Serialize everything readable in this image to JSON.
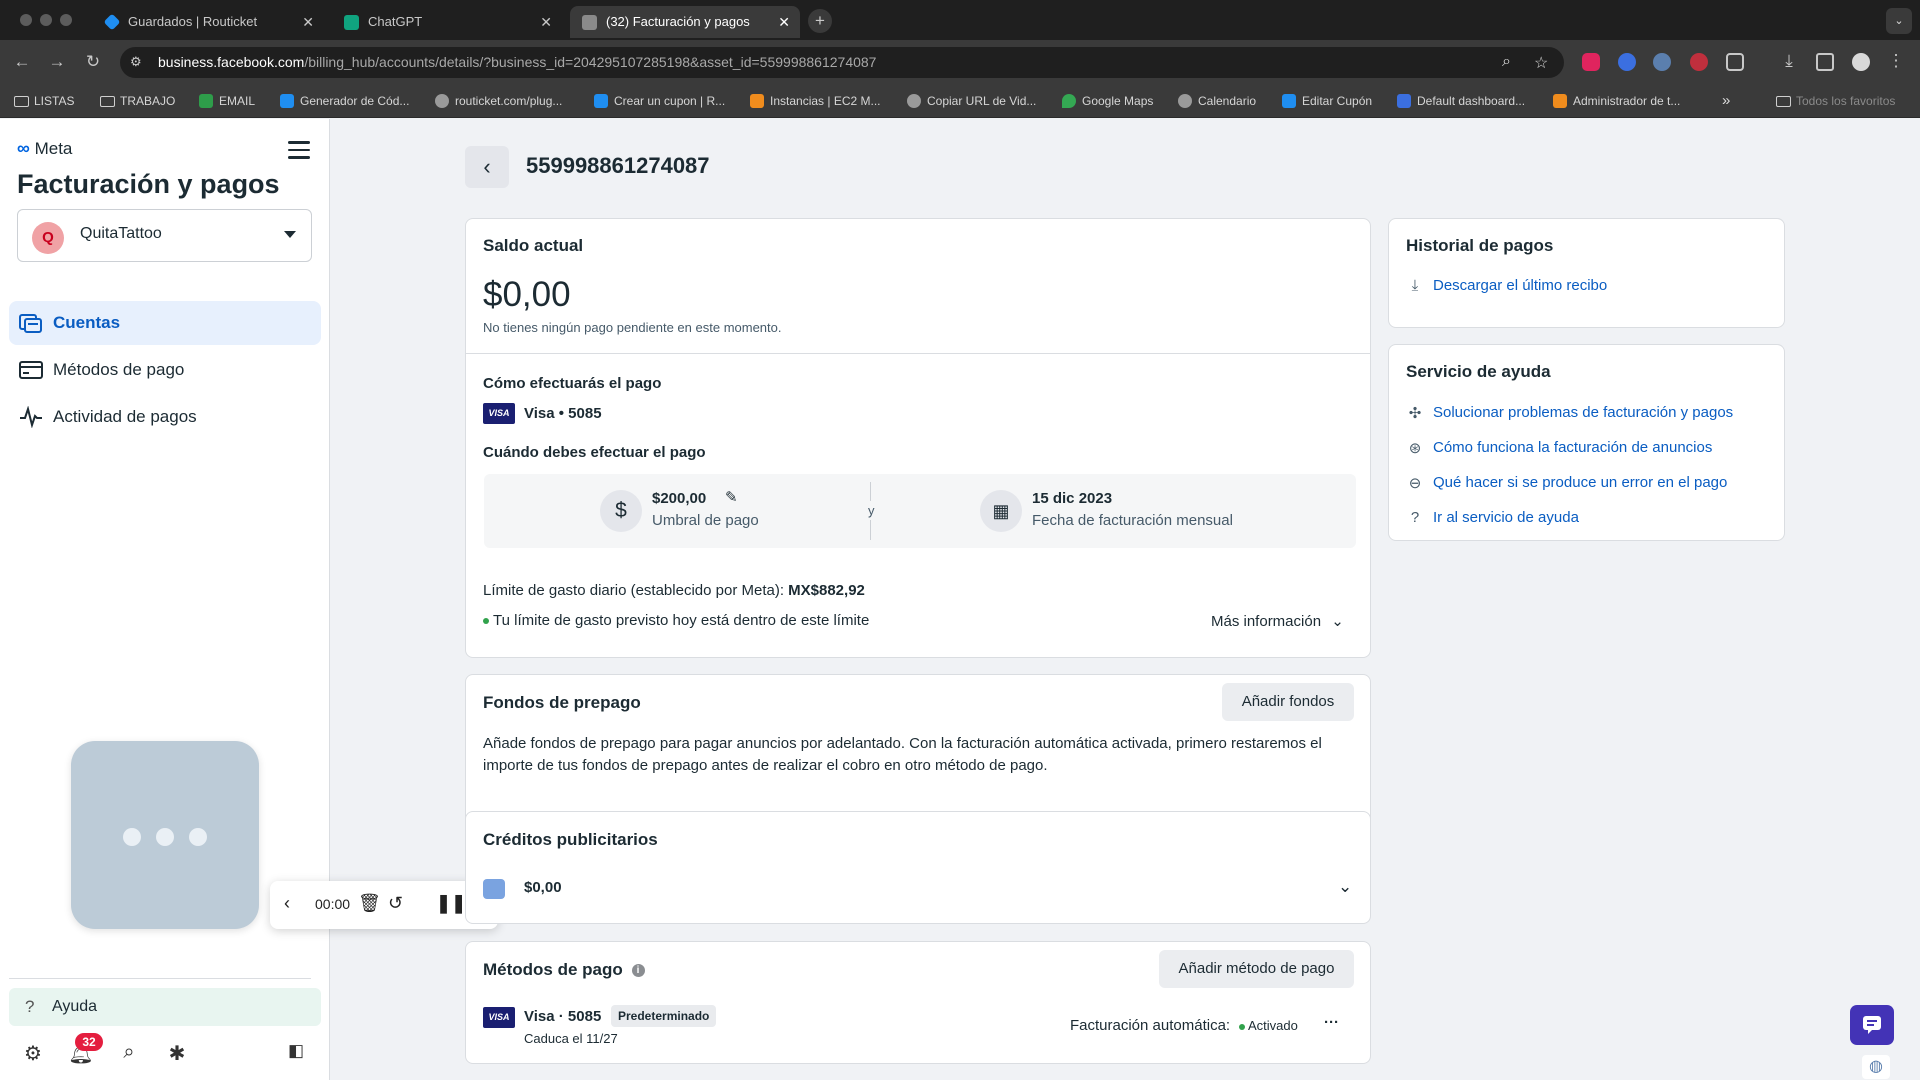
{
  "browser": {
    "tabs": [
      {
        "title": "Guardados | Routicket",
        "favicon_color": "#1f8ef1"
      },
      {
        "title": "ChatGPT",
        "favicon_color": "#10a37f"
      },
      {
        "title": "(32) Facturación y pagos",
        "favicon_color": "#8a8a8a"
      }
    ],
    "new_tab": "+",
    "url_host": "business.facebook.com",
    "url_path": "/billing_hub/accounts/details/?business_id=204295107285198&asset_id=559998861274087",
    "bookmarks": [
      {
        "label": "LISTAS",
        "type": "folder"
      },
      {
        "label": "TRABAJO",
        "type": "folder"
      },
      {
        "label": "EMAIL",
        "type": "site",
        "color": "#2e9d4a"
      },
      {
        "label": "Generador de Cód...",
        "type": "site",
        "color": "#1f8ef1"
      },
      {
        "label": "routicket.com/plug...",
        "type": "site",
        "color": "#9a9a9a"
      },
      {
        "label": "Crear un cupon | R...",
        "type": "site",
        "color": "#1f8ef1"
      },
      {
        "label": "Instancias | EC2 M...",
        "type": "site",
        "color": "#f08c1d"
      },
      {
        "label": "Copiar URL de Vid...",
        "type": "site",
        "color": "#9a9a9a"
      },
      {
        "label": "Google Maps",
        "type": "site",
        "color": "#34a853"
      },
      {
        "label": "Calendario",
        "type": "site",
        "color": "#9a9a9a"
      },
      {
        "label": "Editar Cupón",
        "type": "site",
        "color": "#1f8ef1"
      },
      {
        "label": "Default dashboard...",
        "type": "site",
        "color": "#3b6fe0"
      },
      {
        "label": "Administrador de t...",
        "type": "site",
        "color": "#f08c1d"
      }
    ],
    "all_bookmarks": "Todos los favoritos"
  },
  "sidebar": {
    "brand": "Meta",
    "title": "Facturación y pagos",
    "account": {
      "initial": "Q",
      "name": "QuitaTattoo"
    },
    "nav": [
      {
        "label": "Cuentas",
        "icon": "accounts-icon"
      },
      {
        "label": "Métodos de pago",
        "icon": "credit-card-icon"
      },
      {
        "label": "Actividad de pagos",
        "icon": "activity-icon"
      }
    ],
    "help": "Ayuda",
    "notifications_count": "32"
  },
  "recorder": {
    "timer": "00:00"
  },
  "main": {
    "asset_id": "559998861274087",
    "balance": {
      "heading": "Saldo actual",
      "amount": "$0,00",
      "note": "No tienes ningún pago pendiente en este momento."
    },
    "payment": {
      "how_heading": "Cómo efectuarás el pago",
      "card_brand": "VISA",
      "card": "Visa • 5085",
      "when_heading": "Cuándo debes efectuar el pago",
      "threshold_value": "$200,00",
      "threshold_label": "Umbral de pago",
      "connector": "y",
      "billing_date": "15 dic 2023",
      "billing_date_label": "Fecha de facturación mensual",
      "daily_limit_label": "Límite de gasto diario (establecido por Meta): ",
      "daily_limit_value": "MX$882,92",
      "limit_status": "Tu límite de gasto previsto hoy está dentro de este límite",
      "more_info": "Más información"
    },
    "prepaid": {
      "heading": "Fondos de prepago",
      "button": "Añadir fondos",
      "line1": "Añade fondos de prepago para pagar anuncios por adelantado. Con la facturación automática activada, primero restaremos el",
      "line2": "importe de tus fondos de prepago antes de realizar el cobro en otro método de pago."
    },
    "credits": {
      "heading": "Créditos publicitarios",
      "amount": "$0,00"
    },
    "methods": {
      "heading": "Métodos de pago",
      "button": "Añadir método de pago",
      "card_brand": "VISA",
      "card": "Visa · 5085",
      "default_badge": "Predeterminado",
      "expiry": "Caduca el 11/27",
      "autopay_label": "Facturación automática:",
      "autopay_status": "Activado",
      "more": "···"
    }
  },
  "right": {
    "history": {
      "heading": "Historial de pagos",
      "download": "Descargar el último recibo"
    },
    "support": {
      "heading": "Servicio de ayuda",
      "links": [
        {
          "label": "Solucionar problemas de facturación y pagos",
          "icon": "tools-icon"
        },
        {
          "label": "Cómo funciona la facturación de anuncios",
          "icon": "billing-icon"
        },
        {
          "label": "Qué hacer si se produce un error en el pago",
          "icon": "error-icon"
        },
        {
          "label": "Ir al servicio de ayuda",
          "icon": "help-icon"
        }
      ]
    }
  },
  "colors": {
    "link": "#0a5dc2",
    "active_nav_bg": "#e7f0fd",
    "status_green": "#31a24c",
    "notification_red": "#e41e3f"
  }
}
